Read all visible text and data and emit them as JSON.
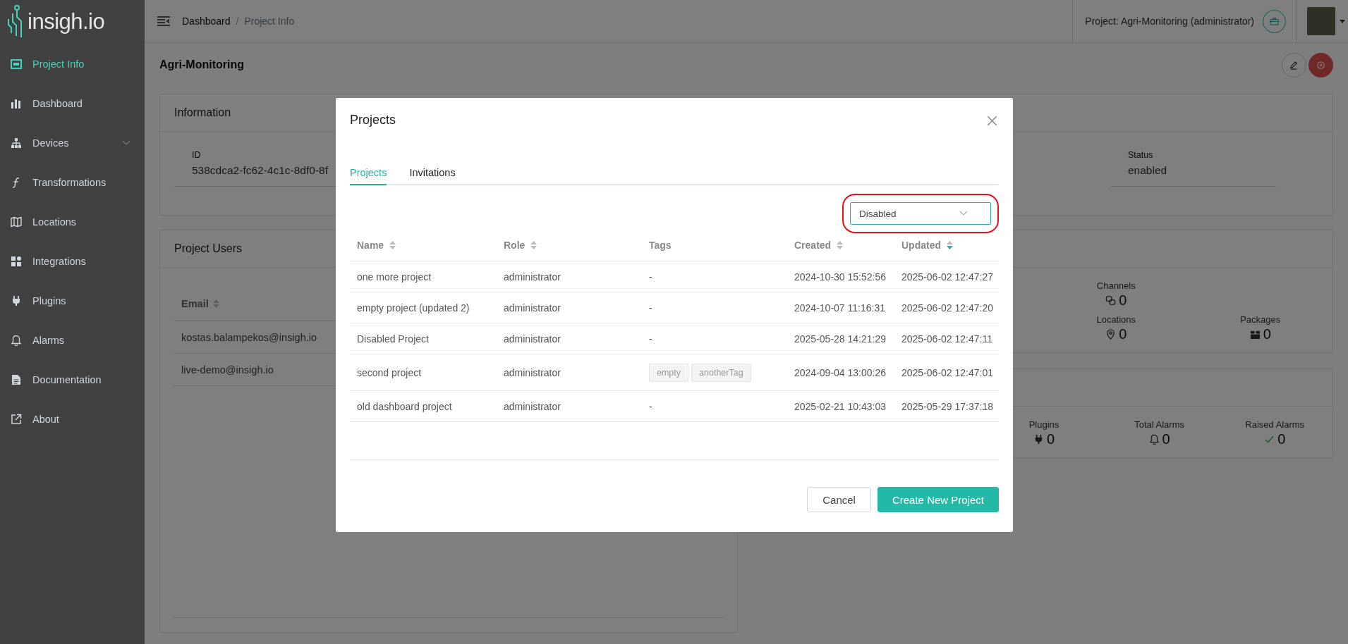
{
  "sidebar": {
    "logo": "insigh.io",
    "items": [
      {
        "label": "Project Info",
        "selected": true,
        "expandable": false
      },
      {
        "label": "Dashboard",
        "selected": false,
        "expandable": false
      },
      {
        "label": "Devices",
        "selected": false,
        "expandable": true
      },
      {
        "label": "Transformations",
        "selected": false,
        "expandable": false
      },
      {
        "label": "Locations",
        "selected": false,
        "expandable": false
      },
      {
        "label": "Integrations",
        "selected": false,
        "expandable": false
      },
      {
        "label": "Plugins",
        "selected": false,
        "expandable": false
      },
      {
        "label": "Alarms",
        "selected": false,
        "expandable": false
      },
      {
        "label": "Documentation",
        "selected": false,
        "expandable": false
      },
      {
        "label": "About",
        "selected": false,
        "expandable": false
      }
    ]
  },
  "header": {
    "breadcrumb": [
      "Dashboard",
      "Project Info"
    ],
    "separator": "/",
    "project": "Project: Agri-Monitoring (administrator)"
  },
  "page": {
    "title": "Agri-Monitoring",
    "information": {
      "title": "Information",
      "fields": [
        {
          "label": "ID",
          "value": "538cdca2-fc62-4c1c-8df0-8f"
        },
        {
          "label": "Status",
          "value": "enabled"
        }
      ]
    },
    "users": {
      "title": "Project Users",
      "column": {
        "label": "Email",
        "sortable": true
      },
      "rows": [
        "kostas.balampekos@insigh.io",
        "live-demo@insigh.io"
      ]
    },
    "stats_cards": [
      {
        "rows": [
          [
            {
              "label": "Channels",
              "value": "0"
            }
          ],
          [
            {
              "label": "Locations",
              "value": "0"
            },
            {
              "label": "Packages",
              "value": "0"
            }
          ]
        ]
      },
      {
        "rows": [
          [
            {
              "label": "Plugins",
              "value": "0"
            },
            {
              "label": "Total Alarms",
              "value": "0"
            },
            {
              "label": "Raised Alarms",
              "value": "0"
            }
          ]
        ]
      }
    ]
  },
  "modal": {
    "title": "Projects",
    "tabs": [
      {
        "label": "Projects",
        "selected": true
      },
      {
        "label": "Invitations",
        "selected": false
      }
    ],
    "filter": {
      "value": "Disabled",
      "highlighted": true
    },
    "columns": [
      {
        "label": "Name",
        "sortable": true,
        "sorted": false
      },
      {
        "label": "Role",
        "sortable": true,
        "sorted": false
      },
      {
        "label": "Tags"
      },
      {
        "label": "Created",
        "sortable": true,
        "sorted": false
      },
      {
        "label": "Updated",
        "sortable": true,
        "sorted": true
      }
    ],
    "rows": [
      {
        "name": "one more project",
        "role": "administrator",
        "tags": "-",
        "created": "2024-10-30 15:52:56",
        "updated": "2025-06-02 12:47:27"
      },
      {
        "name": "empty project (updated 2)",
        "role": "administrator",
        "tags": "-",
        "created": "2024-10-07 11:16:31",
        "updated": "2025-06-02 12:47:20"
      },
      {
        "name": "Disabled Project",
        "role": "administrator",
        "tags": "-",
        "created": "2025-05-28 14:21:29",
        "updated": "2025-06-02 12:47:11"
      },
      {
        "name": "second project",
        "role": "administrator",
        "tags": [
          "empty",
          "anotherTag"
        ],
        "created": "2024-09-04 13:00:26",
        "updated": "2025-06-02 12:47:01"
      },
      {
        "name": "old dashboard project",
        "role": "administrator",
        "tags": "-",
        "created": "2025-02-21 10:43:03",
        "updated": "2025-05-29 17:37:18"
      }
    ],
    "buttons": [
      {
        "label": "Cancel",
        "kind": "secondary"
      },
      {
        "label": "Create New Project",
        "kind": "primary"
      }
    ]
  }
}
